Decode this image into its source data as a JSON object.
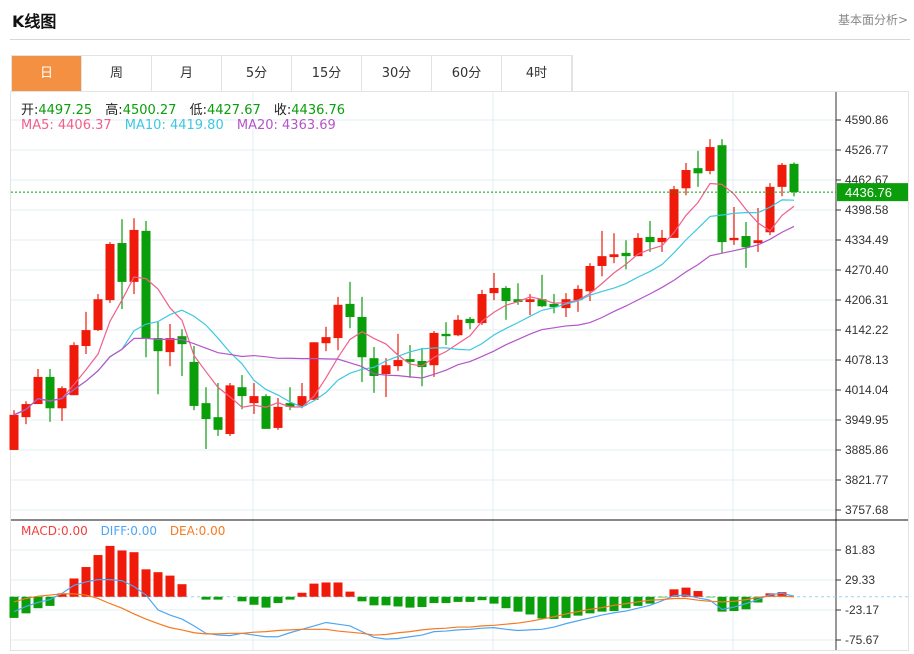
{
  "header": {
    "title": "K线图",
    "link": "基本面分析>"
  },
  "tabs": [
    {
      "label": "日",
      "active": true
    },
    {
      "label": "周"
    },
    {
      "label": "月"
    },
    {
      "label": "5分"
    },
    {
      "label": "15分"
    },
    {
      "label": "30分"
    },
    {
      "label": "60分"
    },
    {
      "label": "4时"
    }
  ],
  "legend": {
    "open_label": "开:",
    "open": "4497.25",
    "high_label": "高:",
    "high": "4500.27",
    "low_label": "低:",
    "low": "4427.67",
    "close_label": "收:",
    "close": "4436.76",
    "ma5_label": "MA5: 4406.37",
    "ma10_label": "MA10: 4419.80",
    "ma20_label": "MA20: 4363.69",
    "macd_label": "MACD:0.00",
    "diff_label": "DIFF:0.00",
    "dea_label": "DEA:0.00"
  },
  "colors": {
    "up": "#f01a0a",
    "down": "#0a9e0a",
    "ma5": "#f0608a",
    "ma10": "#3ec8e0",
    "ma20": "#b455c8",
    "diff": "#4ea6f2",
    "dea": "#f57a22",
    "accent": "#f39041"
  },
  "chart_data": [
    {
      "type": "candlestick",
      "title": "K线图",
      "ylim": [
        3757.68,
        4590.86
      ],
      "y_ticks": [
        "4590.86",
        "4526.77",
        "4462.67",
        "4398.58",
        "4334.49",
        "4270.40",
        "4206.31",
        "4142.22",
        "4078.13",
        "4014.04",
        "3949.95",
        "3885.86",
        "3821.77",
        "3757.68"
      ],
      "last_price": "4436.76",
      "ohlc": [
        [
          3886,
          3971,
          3886,
          3961
        ],
        [
          3956,
          3990,
          3941,
          3984
        ],
        [
          3984,
          4059,
          3984,
          4042
        ],
        [
          4042,
          4059,
          3946,
          3975
        ],
        [
          3975,
          4022,
          3948,
          4018
        ],
        [
          4003,
          4116,
          4003,
          4110
        ],
        [
          4108,
          4181,
          4091,
          4142
        ],
        [
          4142,
          4219,
          4140,
          4208
        ],
        [
          4206,
          4330,
          4200,
          4326
        ],
        [
          4328,
          4379,
          4187,
          4245
        ],
        [
          4245,
          4381,
          4219,
          4356
        ],
        [
          4354,
          4375,
          4084,
          4125
        ],
        [
          4125,
          4161,
          4005,
          4097
        ],
        [
          4095,
          4155,
          4065,
          4125
        ],
        [
          4129,
          4144,
          4044,
          4112
        ],
        [
          4074,
          4108,
          3971,
          3980
        ],
        [
          3986,
          4020,
          3888,
          3952
        ],
        [
          3956,
          4029,
          3916,
          3929
        ],
        [
          3920,
          4029,
          3916,
          4024
        ],
        [
          4020,
          4046,
          3973,
          4001
        ],
        [
          3986,
          4029,
          3963,
          4001
        ],
        [
          4001,
          4005,
          3931,
          3931
        ],
        [
          3933,
          3997,
          3929,
          3978
        ],
        [
          3986,
          4020,
          3971,
          3978
        ],
        [
          3980,
          4029,
          3975,
          4001
        ],
        [
          3993,
          4116,
          3993,
          4116
        ],
        [
          4114,
          4149,
          4097,
          4127
        ],
        [
          4125,
          4213,
          4099,
          4196
        ],
        [
          4198,
          4245,
          4146,
          4170
        ],
        [
          4170,
          4213,
          4031,
          4084
        ],
        [
          4082,
          4106,
          4008,
          4044
        ],
        [
          4048,
          4082,
          3999,
          4067
        ],
        [
          4065,
          4134,
          4055,
          4078
        ],
        [
          4080,
          4110,
          4040,
          4074
        ],
        [
          4076,
          4104,
          4022,
          4063
        ],
        [
          4067,
          4140,
          4042,
          4136
        ],
        [
          4134,
          4159,
          4110,
          4129
        ],
        [
          4131,
          4174,
          4129,
          4164
        ],
        [
          4166,
          4170,
          4144,
          4157
        ],
        [
          4157,
          4228,
          4153,
          4219
        ],
        [
          4221,
          4264,
          4206,
          4232
        ],
        [
          4232,
          4236,
          4164,
          4204
        ],
        [
          4208,
          4242,
          4196,
          4202
        ],
        [
          4202,
          4219,
          4174,
          4208
        ],
        [
          4208,
          4260,
          4191,
          4193
        ],
        [
          4198,
          4219,
          4178,
          4191
        ],
        [
          4189,
          4221,
          4170,
          4208
        ],
        [
          4206,
          4238,
          4181,
          4230
        ],
        [
          4225,
          4285,
          4204,
          4279
        ],
        [
          4279,
          4354,
          4257,
          4300
        ],
        [
          4298,
          4349,
          4285,
          4304
        ],
        [
          4307,
          4334,
          4272,
          4300
        ],
        [
          4300,
          4349,
          4300,
          4339
        ],
        [
          4341,
          4375,
          4309,
          4330
        ],
        [
          4330,
          4356,
          4309,
          4339
        ],
        [
          4339,
          4450,
          4339,
          4443
        ],
        [
          4445,
          4499,
          4430,
          4484
        ],
        [
          4488,
          4525,
          4448,
          4477
        ],
        [
          4482,
          4550,
          4475,
          4533
        ],
        [
          4537,
          4550,
          4307,
          4330
        ],
        [
          4334,
          4405,
          4324,
          4339
        ],
        [
          4343,
          4373,
          4275,
          4319
        ],
        [
          4328,
          4403,
          4309,
          4334
        ],
        [
          4351,
          4456,
          4345,
          4448
        ],
        [
          4448,
          4499,
          4428,
          4495
        ],
        [
          4497.25,
          4500.27,
          4427.67,
          4436.76
        ]
      ],
      "ma_periods": [
        5,
        10,
        20
      ]
    },
    {
      "type": "bar+line",
      "title": "MACD",
      "ylim": [
        -75.67,
        81.83
      ],
      "y_ticks": [
        "81.83",
        "29.33",
        "-23.17",
        "-75.67"
      ],
      "macd": [
        -37,
        -29,
        -20,
        -16,
        6,
        32,
        52,
        73,
        89,
        81,
        78,
        48,
        43,
        37,
        22,
        0,
        -5,
        -5,
        0,
        -8,
        -14,
        -19,
        -11,
        -5,
        7,
        23,
        25,
        25,
        9,
        -8,
        -15,
        -15,
        -17,
        -19,
        -18,
        -11,
        -11,
        -9,
        -9,
        -6,
        -12,
        -20,
        -26,
        -31,
        -38,
        -39,
        -37,
        -33,
        -29,
        -26,
        -25,
        -20,
        -16,
        -12,
        -1,
        13,
        16,
        10,
        -1,
        -26,
        -25,
        -22,
        -10,
        6,
        8,
        0
      ],
      "diff": [
        -26,
        -17,
        -10,
        -5,
        6,
        20,
        26,
        30,
        30,
        28,
        18,
        3,
        -23,
        -32,
        -39,
        -51,
        -64,
        -67,
        -68,
        -64,
        -67,
        -70,
        -70,
        -63,
        -57,
        -51,
        -45,
        -48,
        -51,
        -61,
        -71,
        -74,
        -73,
        -70,
        -67,
        -61,
        -60,
        -58,
        -57,
        -55,
        -54,
        -57,
        -59,
        -58,
        -57,
        -53,
        -47,
        -42,
        -37,
        -32,
        -28,
        -25,
        -20,
        -15,
        -7,
        2,
        3,
        -2,
        -6,
        -22,
        -18,
        -12,
        -5,
        4,
        6,
        1
      ],
      "dea": [
        -9,
        -3,
        1,
        3,
        5,
        5,
        3,
        -3,
        -12,
        -20,
        -30,
        -39,
        -47,
        -54,
        -58,
        -63,
        -65,
        -65,
        -64,
        -64,
        -62,
        -61,
        -59,
        -58,
        -57,
        -57,
        -57,
        -60,
        -62,
        -64,
        -67,
        -66,
        -63,
        -61,
        -58,
        -56,
        -55,
        -53,
        -53,
        -51,
        -50,
        -48,
        -46,
        -43,
        -39,
        -35,
        -30,
        -26,
        -22,
        -19,
        -15,
        -12,
        -9,
        -6,
        -5,
        -3,
        -3,
        -6,
        -8,
        -9,
        -8,
        -5,
        -1,
        1,
        1,
        0
      ]
    }
  ]
}
